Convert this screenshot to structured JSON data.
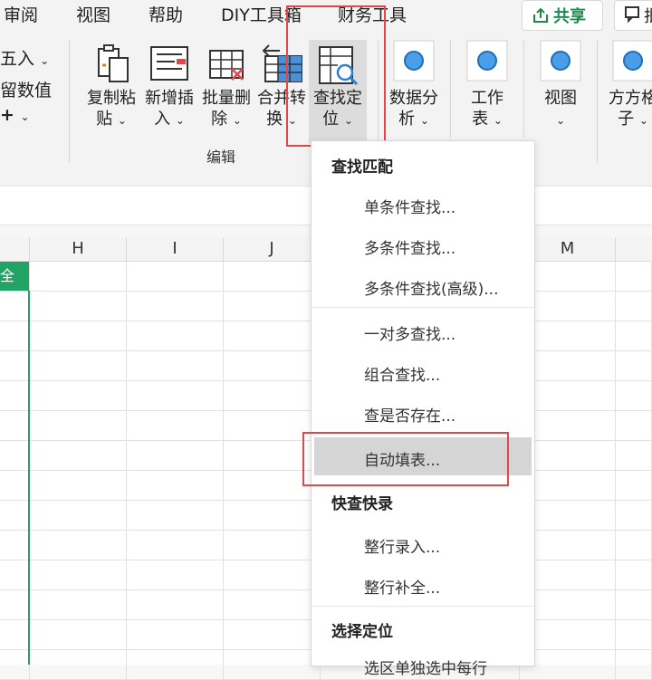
{
  "tabs": [
    "审阅",
    "视图",
    "帮助",
    "DIY工具箱",
    "财务工具"
  ],
  "share": {
    "label": "共享",
    "icon": "share-icon"
  },
  "comment": {
    "label": "批",
    "icon": "comment-icon"
  },
  "left_fragments": {
    "round": "五入",
    "keep_values": "留数值",
    "plus": "+"
  },
  "ribbon_buttons": [
    {
      "id": "copy-paste",
      "line1": "复制粘",
      "line2": "贴",
      "icon": "copy-paste-icon"
    },
    {
      "id": "insert",
      "line1": "新增插",
      "line2": "入",
      "icon": "insert-icon"
    },
    {
      "id": "batch-delete",
      "line1": "批量删",
      "line2": "除",
      "icon": "batch-delete-icon"
    },
    {
      "id": "merge-convert",
      "line1": "合并转",
      "line2": "换",
      "icon": "merge-convert-icon"
    },
    {
      "id": "find-locate",
      "line1": "查找定",
      "line2": "位",
      "icon": "find-locate-icon"
    },
    {
      "id": "data-analysis",
      "line1": "数据分",
      "line2": "析",
      "icon": "circle-icon"
    },
    {
      "id": "worksheet",
      "line1": "工作",
      "line2": "表",
      "icon": "circle-icon"
    },
    {
      "id": "view",
      "line1": "视图",
      "line2": "",
      "icon": "circle-icon"
    },
    {
      "id": "fangfang",
      "line1": "方方格",
      "line2": "子",
      "icon": "circle-icon"
    }
  ],
  "group_label": "编辑",
  "columns": [
    "H",
    "I",
    "J",
    "M"
  ],
  "green_cell_text": "全",
  "menu": {
    "sections": [
      {
        "header": "查找匹配",
        "items": [
          "单条件查找...",
          "多条件查找...",
          "多条件查找(高级)..."
        ]
      },
      {
        "header": "",
        "items": [
          "一对多查找...",
          "组合查找...",
          "查是否存在...",
          "自动填表..."
        ]
      },
      {
        "header": "快查快录",
        "items": [
          "整行录入...",
          "整行补全..."
        ]
      },
      {
        "header": "选择定位",
        "items": [
          "选区单独选中每行"
        ]
      }
    ]
  },
  "highlight_item": "自动填表..."
}
